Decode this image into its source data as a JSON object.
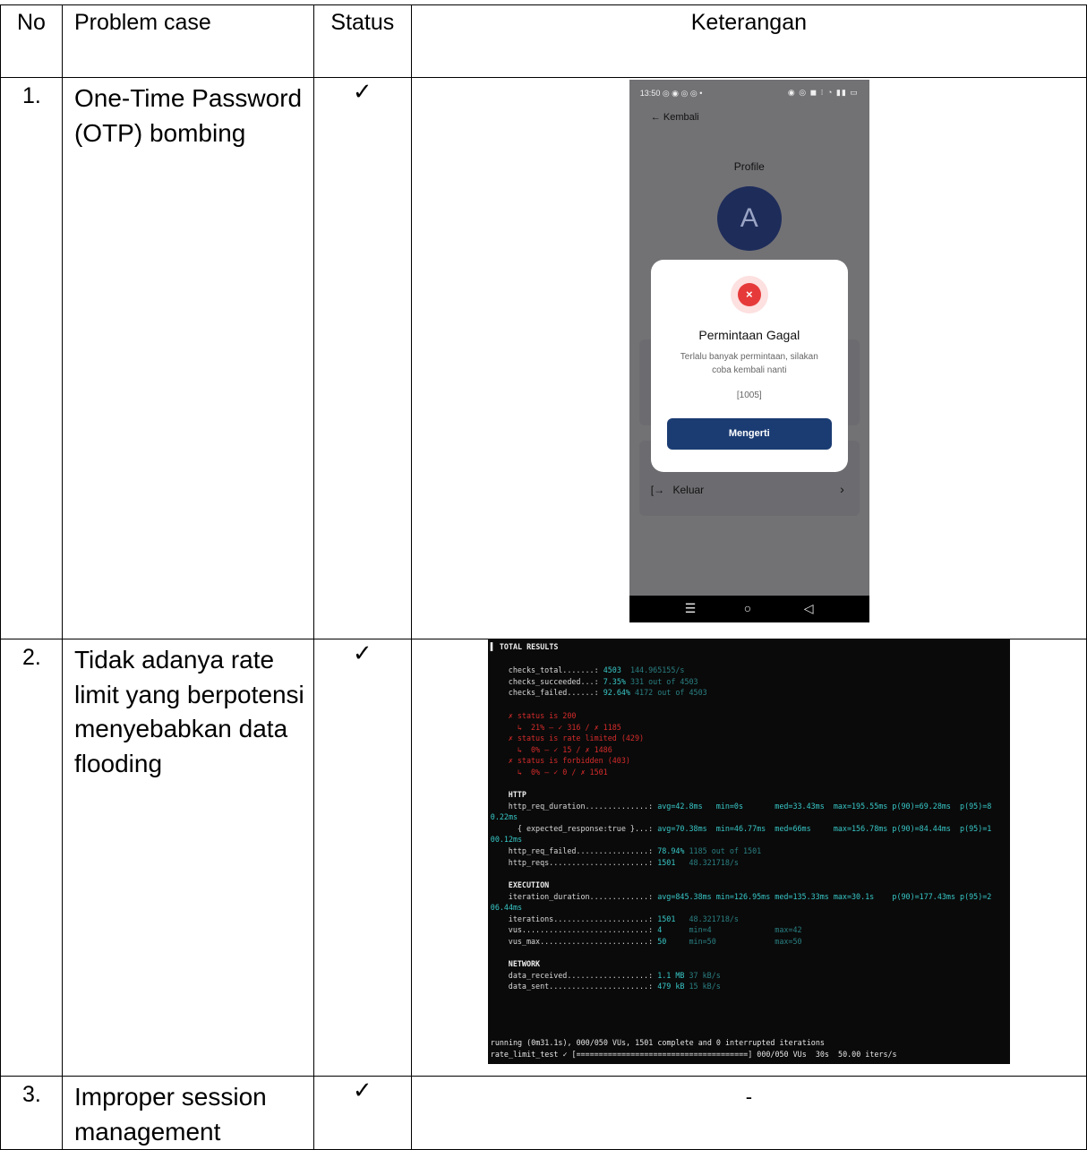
{
  "table": {
    "headers": {
      "no": "No",
      "problem_case": "Problem case",
      "status": "Status",
      "keterangan": "Keterangan"
    },
    "rows": [
      {
        "no": "1.",
        "problem_case": "One-Time Password (OTP) bombing",
        "status": "✓"
      },
      {
        "no": "2.",
        "problem_case": "Tidak adanya rate limit yang berpotensi menyebabkan data flooding",
        "status": "✓"
      },
      {
        "no": "3.",
        "problem_case": "Improper session management",
        "status": "✓",
        "keterangan": "-"
      }
    ]
  },
  "phone": {
    "status_time": "13:50 ◎ ◉ ◎ ◎ •",
    "status_right": "◉ ◎ ◼ ⁝ ◔ ▮▮ ▭",
    "back_label": "Kembali",
    "page_title": "Profile",
    "avatar_letter": "A",
    "dialog_title": "Permintaan Gagal",
    "dialog_message": "Terlalu banyak permintaan, silakan coba kembali nanti",
    "dialog_code": "[1005]",
    "dialog_button": "Mengerti",
    "logout_label": "Keluar"
  },
  "terminal": {
    "section_total": "TOTAL RESULTS",
    "lines": [
      {
        "k": "checks_total.......: ",
        "v": "4503",
        "d": "  144.965155/s"
      },
      {
        "k": "checks_succeeded...: ",
        "v": "7.35%",
        "d": " 331 out of 4503"
      },
      {
        "k": "checks_failed......: ",
        "v": "92.64%",
        "d": " 4172 out of 4503"
      }
    ],
    "checks": [
      "✗ status is 200",
      "  ↳  21% — ✓ 316 / ✗ 1185",
      "✗ status is rate limited (429)",
      "  ↳  0% — ✓ 15 / ✗ 1486",
      "✗ status is forbidden (403)",
      "  ↳  0% — ✓ 0 / ✗ 1501"
    ],
    "http_header": "HTTP",
    "http_req_duration_key": "http_req_duration..............: ",
    "http_req_duration_val": "avg=42.8ms   min=0s       med=33.43ms  max=195.55ms p(90)=69.28ms  p(95)=8",
    "http_req_duration_wrap": "0.22ms",
    "expected_key": "  { expected_response:true }...: ",
    "expected_val": "avg=70.38ms  min=46.77ms  med=66ms     max=156.78ms p(90)=84.44ms  p(95)=1",
    "expected_wrap": "00.12ms",
    "http_req_failed_key": "http_req_failed................: ",
    "http_req_failed_val": "78.94%",
    "http_req_failed_dim": " 1185 out of 1501",
    "http_reqs_key": "http_reqs......................: ",
    "http_reqs_val": "1501",
    "http_reqs_dim": "   48.321718/s",
    "exec_header": "EXECUTION",
    "iter_dur_key": "iteration_duration.............: ",
    "iter_dur_val": "avg=845.38ms min=126.95ms med=135.33ms max=30.1s    p(90)=177.43ms p(95)=2",
    "iter_dur_wrap": "06.44ms",
    "iterations_key": "iterations.....................: ",
    "iterations_val": "1501",
    "iterations_dim": "   48.321718/s",
    "vus_key": "vus............................: ",
    "vus_val": "4",
    "vus_dim": "      min=4              max=42",
    "vus_max_key": "vus_max........................: ",
    "vus_max_val": "50",
    "vus_max_dim": "     min=50             max=50",
    "net_header": "NETWORK",
    "data_recv_key": "data_received..................: ",
    "data_recv_val": "1.1 MB",
    "data_recv_dim": " 37 kB/s",
    "data_sent_key": "data_sent......................: ",
    "data_sent_val": "479 kB",
    "data_sent_dim": " 15 kB/s",
    "running_line": "running (0m31.1s), 000/050 VUs, 1501 complete and 0 interrupted iterations",
    "progress_line": "rate_limit_test ✓ [======================================] 000/050 VUs  30s  50.00 iters/s"
  }
}
